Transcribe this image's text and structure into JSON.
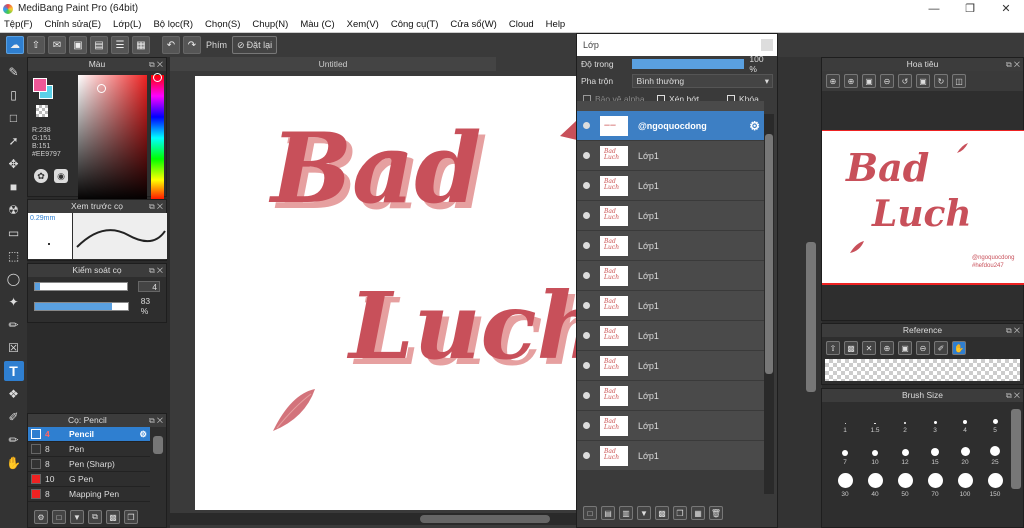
{
  "app": {
    "title": "MediBang Paint Pro (64bit)"
  },
  "menu": [
    "Tệp(F)",
    "Chỉnh sửa(E)",
    "Lớp(L)",
    "Bộ lọc(R)",
    "Chọn(S)",
    "Chụp(N)",
    "Màu (C)",
    "Xem(V)",
    "Công cụ(T)",
    "Cửa sổ(W)",
    "Cloud",
    "Help"
  ],
  "toolbar": {
    "key_label": "Phím",
    "reset_label": "Đặt lại"
  },
  "color_panel": {
    "title": "Màu",
    "r": "R:238",
    "g": "G:151",
    "b": "B:151",
    "hex": "#EE9797",
    "fg": "#ee5797",
    "bg": "#5ad0e8"
  },
  "brush_preview": {
    "title": "Xem trước cọ",
    "size": "0.29mm"
  },
  "brush_control": {
    "title": "Kiểm soát cọ",
    "size": "4",
    "opacity": "83 %",
    "size_fraction": 0.05,
    "opacity_fraction": 0.83
  },
  "brush_list": {
    "title": "Cọ: Pencil",
    "items": [
      {
        "size": "4",
        "name": "Pencil",
        "color": "#2f7fd0",
        "selected": true
      },
      {
        "size": "8",
        "name": "Pen",
        "color": "#333",
        "selected": false
      },
      {
        "size": "8",
        "name": "Pen (Sharp)",
        "color": "#333",
        "selected": false
      },
      {
        "size": "10",
        "name": "G Pen",
        "color": "#e22",
        "selected": false
      },
      {
        "size": "8",
        "name": "Mapping Pen",
        "color": "#e22",
        "selected": false
      }
    ]
  },
  "document": {
    "tab": "Untitled",
    "text_line1": "Bad",
    "text_line2": "Luch"
  },
  "layer_panel": {
    "title": "Lớp",
    "opacity_label": "Độ trong",
    "opacity_value": "100 %",
    "opacity_fraction": 1.0,
    "blend_label": "Pha trộn",
    "blend_value": "Bình thường",
    "protect_alpha": "Bảo vệ alpha",
    "clip": "Xén bớt",
    "lock": "Khóa",
    "layers": [
      {
        "name": "@ngoquocdong",
        "selected": true
      },
      {
        "name": "Lớp1",
        "selected": false
      },
      {
        "name": "Lớp1",
        "selected": false
      },
      {
        "name": "Lớp1",
        "selected": false
      },
      {
        "name": "Lớp1",
        "selected": false
      },
      {
        "name": "Lớp1",
        "selected": false
      },
      {
        "name": "Lớp1",
        "selected": false
      },
      {
        "name": "Lớp1",
        "selected": false
      },
      {
        "name": "Lớp1",
        "selected": false
      },
      {
        "name": "Lớp1",
        "selected": false
      },
      {
        "name": "Lớp1",
        "selected": false
      },
      {
        "name": "Lớp1",
        "selected": false
      }
    ]
  },
  "navigator": {
    "title": "Hoa tiêu",
    "text_line1": "Bad",
    "text_line2": "Luch",
    "credit1": "@ngoquocdong",
    "credit2": "#hefdou247"
  },
  "reference": {
    "title": "Reference"
  },
  "brush_size": {
    "title": "Brush Size",
    "sizes": [
      "1",
      "1.5",
      "2",
      "3",
      "4",
      "5",
      "7",
      "10",
      "12",
      "15",
      "20",
      "25",
      "30",
      "40",
      "50",
      "70",
      "100",
      "150"
    ]
  }
}
